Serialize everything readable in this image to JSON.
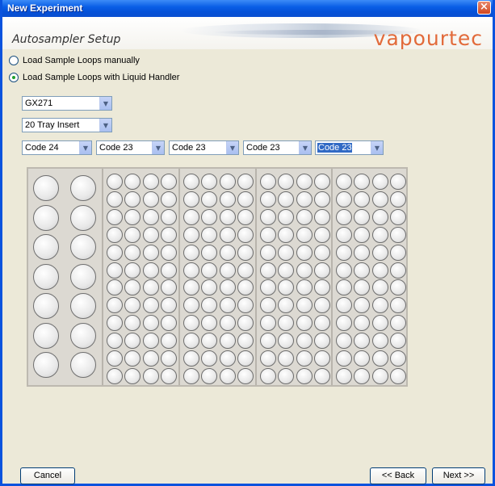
{
  "window": {
    "title": "New Experiment"
  },
  "header": {
    "section_title": "Autosampler Setup",
    "logo_text": "vapourtec"
  },
  "options": {
    "manual_label": "Load Sample Loops manually",
    "liquid_handler_label": "Load Sample Loops with Liquid Handler",
    "selected": "liquid_handler"
  },
  "selects": {
    "handler": "GX271",
    "tray_insert": "20 Tray Insert",
    "racks": [
      "Code 24",
      "Code 23",
      "Code 23",
      "Code 23",
      "Code 23"
    ]
  },
  "rack_layout": {
    "rack1": {
      "columns": 2,
      "rows": 7
    },
    "racks_2_to_5": {
      "columns": 4,
      "rows": 12
    }
  },
  "buttons": {
    "cancel": "Cancel",
    "back": "<< Back",
    "next": "Next >>"
  },
  "colors": {
    "accent": "#0a53de",
    "logo": "#e26a3a",
    "selection": "#316ac5"
  }
}
